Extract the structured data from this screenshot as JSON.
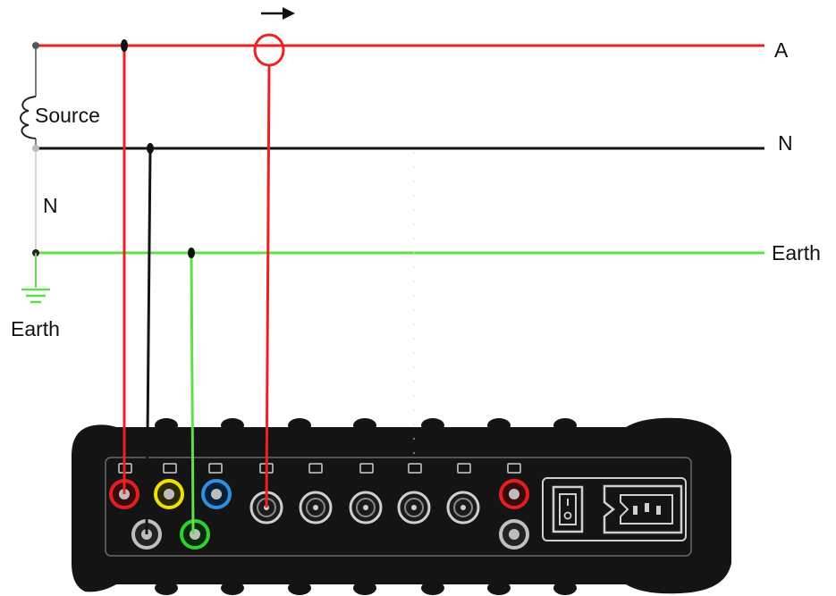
{
  "labels": {
    "phase_a": "A",
    "neutral_right": "N",
    "earth_right": "Earth",
    "source": "Source",
    "neutral_left": "N",
    "earth_left": "Earth"
  },
  "colors": {
    "phase": "#ee2020",
    "neutral": "#141414",
    "earth": "#5fe04a",
    "device_body": "#141414",
    "jack_red": "#e02020",
    "jack_yellow": "#f0e000",
    "jack_blue": "#2f8fe0",
    "jack_green": "#30d030",
    "jack_grey": "#bfbfbf"
  },
  "icons": {
    "current_direction": "arrow-right-icon",
    "current_clamp": "current-clamp-icon",
    "source": "coil-icon",
    "ground": "ground-icon",
    "power_switch": "power-switch-icon",
    "power_inlet": "iec-power-inlet-icon"
  }
}
